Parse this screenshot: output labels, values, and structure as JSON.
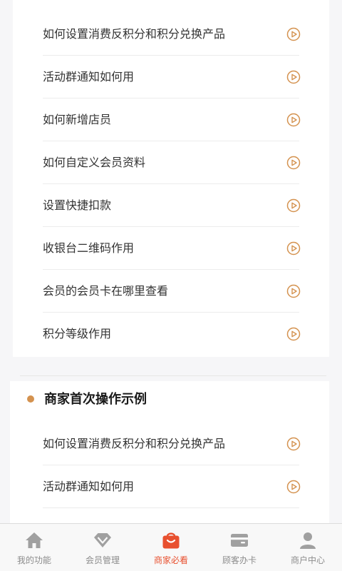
{
  "list1": {
    "items": [
      {
        "label": "如何设置消费反积分和积分兑换产品"
      },
      {
        "label": "活动群通知如何用"
      },
      {
        "label": "如何新增店员"
      },
      {
        "label": "如何自定义会员资料"
      },
      {
        "label": "设置快捷扣款"
      },
      {
        "label": "收银台二维码作用"
      },
      {
        "label": "会员的会员卡在哪里查看"
      },
      {
        "label": "积分等级作用"
      }
    ]
  },
  "section2": {
    "title": "商家首次操作示例",
    "items": [
      {
        "label": "如何设置消费反积分和积分兑换产品"
      },
      {
        "label": "活动群通知如何用"
      }
    ]
  },
  "tabbar": {
    "tabs": [
      {
        "label": "我的功能",
        "icon": "home-icon"
      },
      {
        "label": "会员管理",
        "icon": "diamond-icon"
      },
      {
        "label": "商家必看",
        "icon": "shopping-bag-icon",
        "active": true
      },
      {
        "label": "顾客办卡",
        "icon": "wallet-card-icon"
      },
      {
        "label": "商户中心",
        "icon": "user-icon"
      }
    ]
  },
  "colors": {
    "accent": "#e8502f",
    "play_icon": "#d4924f",
    "tab_inactive": "#a0a0a0",
    "section_dot": "#d4924f"
  }
}
